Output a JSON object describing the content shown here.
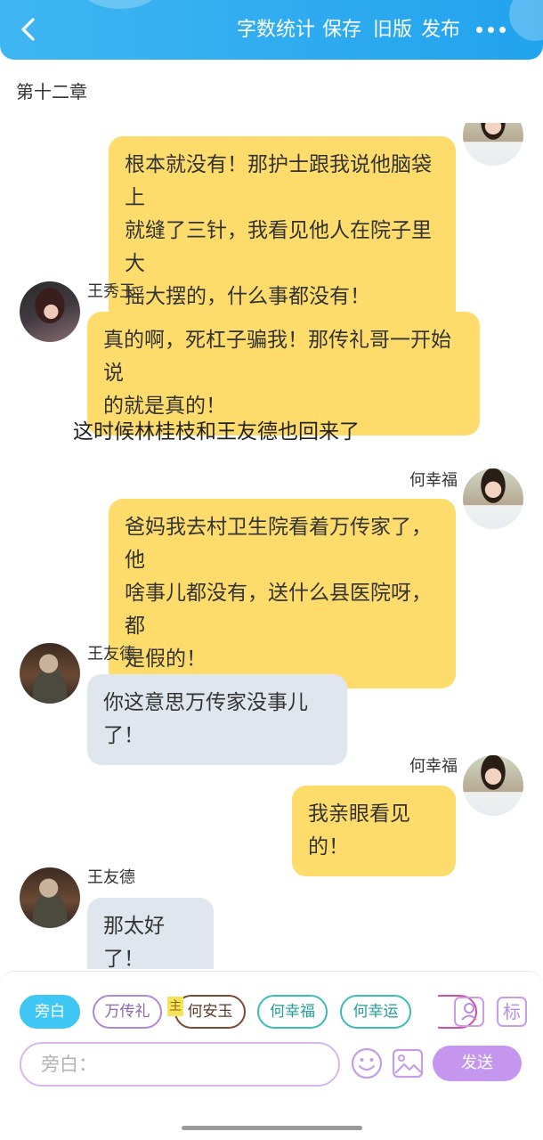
{
  "header": {
    "back_icon": "chevron-left-icon",
    "menu": [
      "字数统计",
      "保存",
      "旧版",
      "发布"
    ],
    "more_icon": "more-horizontal-icon",
    "background": "#29a9ef"
  },
  "chapter_title": "第十二章",
  "messages": [
    {
      "side": "right",
      "speaker": "",
      "text_lines": [
        "根本就没有！那护士跟我说他脑袋上",
        "就缝了三针，我看见他人在院子里大",
        "摇大摆的，什么事都没有！"
      ]
    },
    {
      "side": "left",
      "speaker": "王秀玉",
      "text_lines": [
        "真的啊，死杠子骗我！那传礼哥一开始说",
        "的就是真的！"
      ]
    },
    {
      "side": "narration",
      "text": "这时候林桂枝和王友德也回来了"
    },
    {
      "side": "right",
      "speaker": "何幸福",
      "text_lines": [
        "爸妈我去村卫生院看着万传家了，他",
        "啥事儿都没有，送什么县医院呀，都",
        "是假的！"
      ]
    },
    {
      "side": "left",
      "speaker": "王友德",
      "text_lines": [
        "你这意思万传家没事儿了！"
      ]
    },
    {
      "side": "right",
      "speaker": "何幸福",
      "text_lines": [
        "我亲眼看见的！"
      ]
    },
    {
      "side": "left",
      "speaker": "王友德",
      "text_lines": [
        "那太好了！"
      ]
    }
  ],
  "composer": {
    "roles": [
      "旁白",
      "万传礼",
      "何安玉",
      "何幸福",
      "何幸运"
    ],
    "protagonist_badge": "主",
    "input_placeholder": "旁白：",
    "send_label": "发送",
    "role_icon": "person-card-icon",
    "tag_icon_text": "标",
    "emoji_icon": "smile-icon",
    "image_icon": "image-icon"
  },
  "colors": {
    "bubble_self": "#fedc6c",
    "bubble_other": "#e0e6ee",
    "send_button": "#c596ee",
    "active_chip": "#3ec6f5"
  }
}
